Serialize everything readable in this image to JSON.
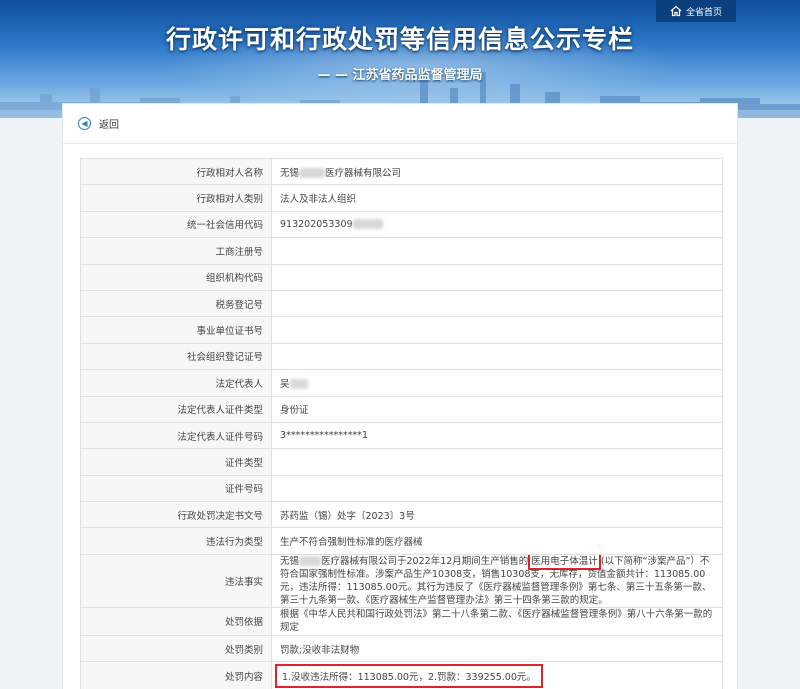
{
  "header": {
    "title": "行政许可和行政处罚等信用信息公示专栏",
    "subtitle": "— — 江苏省药品监督管理局",
    "home_label": "全省首页"
  },
  "back_label": "返回",
  "colors": {
    "banner": "#2c78c8",
    "highlight": "#e0232a"
  },
  "rows": [
    {
      "key": "行政相对人名称",
      "value_pre": "无锡",
      "value_post": "医疗器械有限公司"
    },
    {
      "key": "行政相对人类别",
      "value": "法人及非法人组织"
    },
    {
      "key": "统一社会信用代码",
      "value": "913202053309"
    },
    {
      "key": "工商注册号",
      "value": ""
    },
    {
      "key": "组织机构代码",
      "value": ""
    },
    {
      "key": "税务登记号",
      "value": ""
    },
    {
      "key": "事业单位证书号",
      "value": ""
    },
    {
      "key": "社会组织登记证号",
      "value": ""
    },
    {
      "key": "法定代表人",
      "value": "吴"
    },
    {
      "key": "法定代表人证件类型",
      "value": "身份证"
    },
    {
      "key": "法定代表人证件号码",
      "value": "3****************1"
    },
    {
      "key": "证件类型",
      "value": ""
    },
    {
      "key": "证件号码",
      "value": ""
    },
    {
      "key": "行政处罚决定书文号",
      "value": "苏药监（锡）处字〔2023〕3号"
    },
    {
      "key": "违法行为类型",
      "value": "生产不符合强制性标准的医疗器械"
    },
    {
      "key": "违法事实",
      "value_pre": "无锡",
      "value_a": "医疗器械有限公司于2022年12月期间生产销售的",
      "value_hl": "医用电子体温计",
      "value_b": "(以下简称“涉案产品”）不符合国家强制性标准。涉案产品生产10308支，销售10308支，无库存，货值金额共计：113085.00元，违法所得：113085.00元。其行为违反了《医疗器械监督管理条例》第七条、第三十五条第一款、第三十九条第一款、《医疗器械生产监督管理办法》第三十四条第三款的规定。"
    },
    {
      "key": "处罚依据",
      "value": "根据《中华人民共和国行政处罚法》第二十八条第二款、《医疗器械监督管理条例》第八十六条第一款的规定"
    },
    {
      "key": "处罚类别",
      "value": "罚款;没收非法财物"
    },
    {
      "key": "处罚内容",
      "value": "1.没收违法所得：113085.00元，2.罚款：339255.00元。"
    }
  ]
}
